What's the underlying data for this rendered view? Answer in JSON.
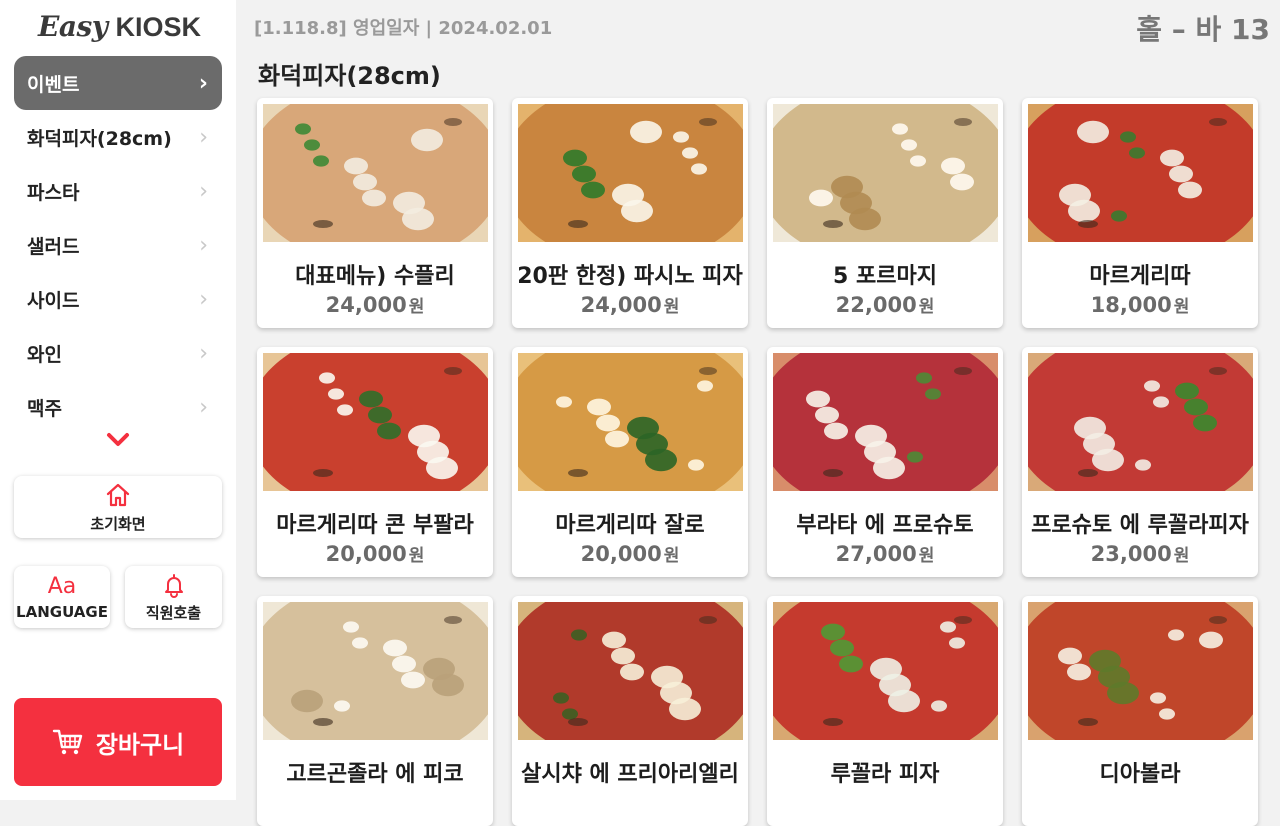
{
  "app": {
    "logo_easy": "Easy",
    "logo_kiosk": "KIOSK",
    "version_info": "[1.118.8]  영업일자 | 2024.02.01",
    "table": "홀 – 바 13"
  },
  "sidebar": {
    "items": [
      {
        "label": "이벤트",
        "active": true
      },
      {
        "label": "화덕피자(28cm)",
        "active": false
      },
      {
        "label": "파스타",
        "active": false
      },
      {
        "label": "샐러드",
        "active": false
      },
      {
        "label": "사이드",
        "active": false
      },
      {
        "label": "와인",
        "active": false
      },
      {
        "label": "맥주",
        "active": false
      }
    ],
    "home_label": "초기화면",
    "language_icon": "Aa",
    "language_label": "LANGUAGE",
    "call_staff_label": "직원호출",
    "cart_label": "장바구니"
  },
  "main": {
    "category_title": "화덕피자(28cm)",
    "currency": "원",
    "products": [
      {
        "name": "대표메뉴) 수플리",
        "price": "24,000"
      },
      {
        "name": "20판 한정) 파시노 피자",
        "price": "24,000"
      },
      {
        "name": "5 포르마지",
        "price": "22,000"
      },
      {
        "name": "마르게리따",
        "price": "18,000"
      },
      {
        "name": "마르게리따 콘 부팔라",
        "price": "20,000"
      },
      {
        "name": "마르게리따 잘로",
        "price": "20,000"
      },
      {
        "name": "부라타 에 프로슈토",
        "price": "27,000"
      },
      {
        "name": "프로슈토 에 루꼴라피자",
        "price": "23,000"
      },
      {
        "name": "고르곤졸라 에 피코",
        "price": ""
      },
      {
        "name": "살시챠 에 프리아리엘리",
        "price": ""
      },
      {
        "name": "루꼴라 피자",
        "price": ""
      },
      {
        "name": "디아볼라",
        "price": ""
      }
    ]
  },
  "colors": {
    "accent_red": "#f4303f",
    "active_menu_bg": "#6b6b6b"
  }
}
